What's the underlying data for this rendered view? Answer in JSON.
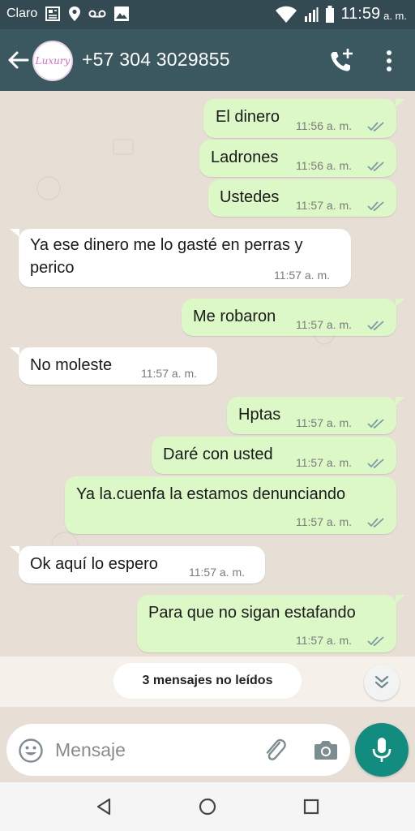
{
  "status_bar": {
    "carrier": "Claro",
    "time": "11:59",
    "ampm": "a. m.",
    "icons": [
      "news-icon",
      "location-icon",
      "voicemail-icon",
      "image-icon",
      "wifi-icon",
      "signal-icon",
      "battery-icon"
    ]
  },
  "header": {
    "contact": "+57 304 3029855",
    "avatar_text": "Luxury",
    "icons": [
      "back-arrow-icon",
      "add-call-icon",
      "more-vert-icon"
    ]
  },
  "messages": [
    {
      "dir": "out",
      "text": "El dinero",
      "time": "11:56 a. m."
    },
    {
      "dir": "out",
      "text": "Ladrones",
      "time": "11:56 a. m."
    },
    {
      "dir": "out",
      "text": "Ustedes",
      "time": "11:57 a. m."
    },
    {
      "dir": "in",
      "text": "Ya ese dinero me lo gasté en perras y",
      "text2": "perico",
      "time": "11:57 a. m."
    },
    {
      "dir": "out",
      "text": "Me robaron",
      "time": "11:57 a. m."
    },
    {
      "dir": "in",
      "text": "No moleste",
      "time": "11:57 a. m."
    },
    {
      "dir": "out",
      "text": "Hptas",
      "time": "11:57 a. m."
    },
    {
      "dir": "out",
      "text": "Daré con usted",
      "time": "11:57 a. m."
    },
    {
      "dir": "out",
      "text": "Ya la.cuenfa la estamos denunciando",
      "time": "11:57 a. m."
    },
    {
      "dir": "in",
      "text": "Ok aquí lo espero",
      "time": "11:57 a. m."
    },
    {
      "dir": "out",
      "text": "Para que no sigan estafando",
      "time": "11:57 a. m."
    }
  ],
  "unread": {
    "label": "3 mensajes no leídos"
  },
  "input": {
    "placeholder": "Mensaje"
  },
  "colors": {
    "header": "#3b5860",
    "status": "#344a52",
    "outgoing": "#dcf8c6",
    "incoming": "#ffffff",
    "mic": "#128c7e",
    "tick": "#7b9ca6"
  }
}
